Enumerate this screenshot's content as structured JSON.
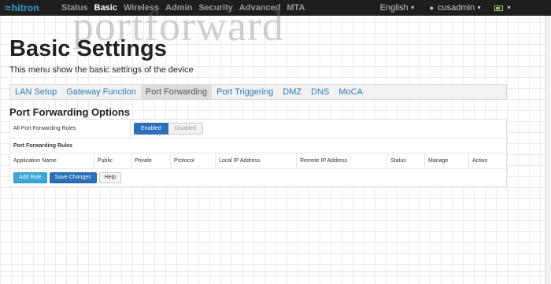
{
  "navbar": {
    "logo_mark": "≈",
    "logo_text": "hitron",
    "items": [
      "Status",
      "Basic",
      "Wireless",
      "Admin",
      "Security",
      "Advanced",
      "MTA"
    ],
    "active": "Basic",
    "language": "English",
    "user": "cusadmin"
  },
  "watermark": "portforward",
  "page": {
    "title": "Basic Settings",
    "subtitle": "This menu show the basic settings of the device"
  },
  "tabs": [
    "LAN Setup",
    "Gateway Function",
    "Port Forwarding",
    "Port Triggering",
    "DMZ",
    "DNS",
    "MoCA"
  ],
  "active_tab": "Port Forwarding",
  "section_title": "Port Forwarding Options",
  "all_rules": {
    "label": "All Port Forwarding Rules",
    "enabled_label": "Enabled",
    "disabled_label": "Disabled",
    "state": "Enabled"
  },
  "rules": {
    "title": "Port Forwarding Rules",
    "columns": [
      "Application Name",
      "Public",
      "Private",
      "Protocol",
      "Local IP Address",
      "Remote IP Address",
      "Status",
      "Manage",
      "Action"
    ],
    "rows": []
  },
  "buttons": {
    "add_rule": "Add Rule",
    "save_changes": "Save Changes",
    "help": "Help"
  }
}
